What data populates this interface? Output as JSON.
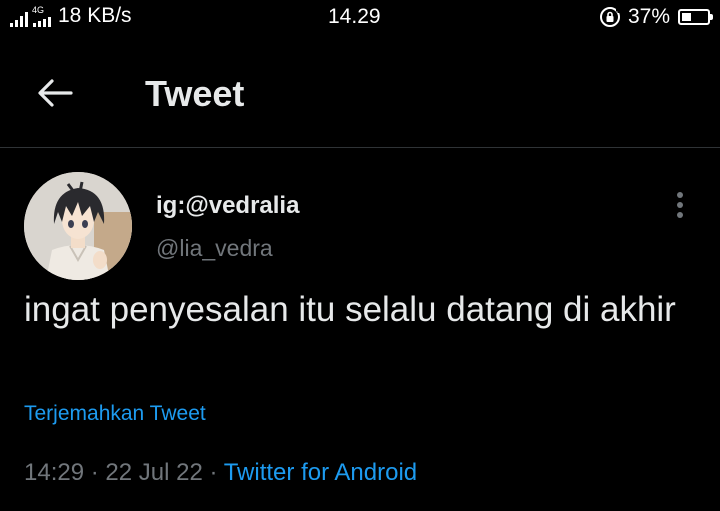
{
  "status_bar": {
    "network_type": "4G",
    "speed": "18 KB/s",
    "time": "14.29",
    "battery_percent": "37%",
    "battery_level": 0.37,
    "icons": [
      "signal-icon",
      "mobile-data-icon",
      "rotation-lock-icon",
      "battery-icon"
    ]
  },
  "header": {
    "title": "Tweet",
    "back_icon": "arrow-left-icon"
  },
  "tweet": {
    "display_name": "ig:@vedralia",
    "handle": "@lia_vedra",
    "text": "ingat penyesalan itu selalu datang di akhir",
    "translate_label": "Terjemahkan Tweet",
    "time": "14:29",
    "separator": "·",
    "date": "22 Jul 22",
    "source": "Twitter for Android",
    "more_icon": "more-vertical-icon"
  },
  "colors": {
    "background": "#000000",
    "text_primary": "#e7e9ea",
    "text_secondary": "#71767b",
    "accent": "#1d9bf0",
    "divider": "#2f3336"
  }
}
